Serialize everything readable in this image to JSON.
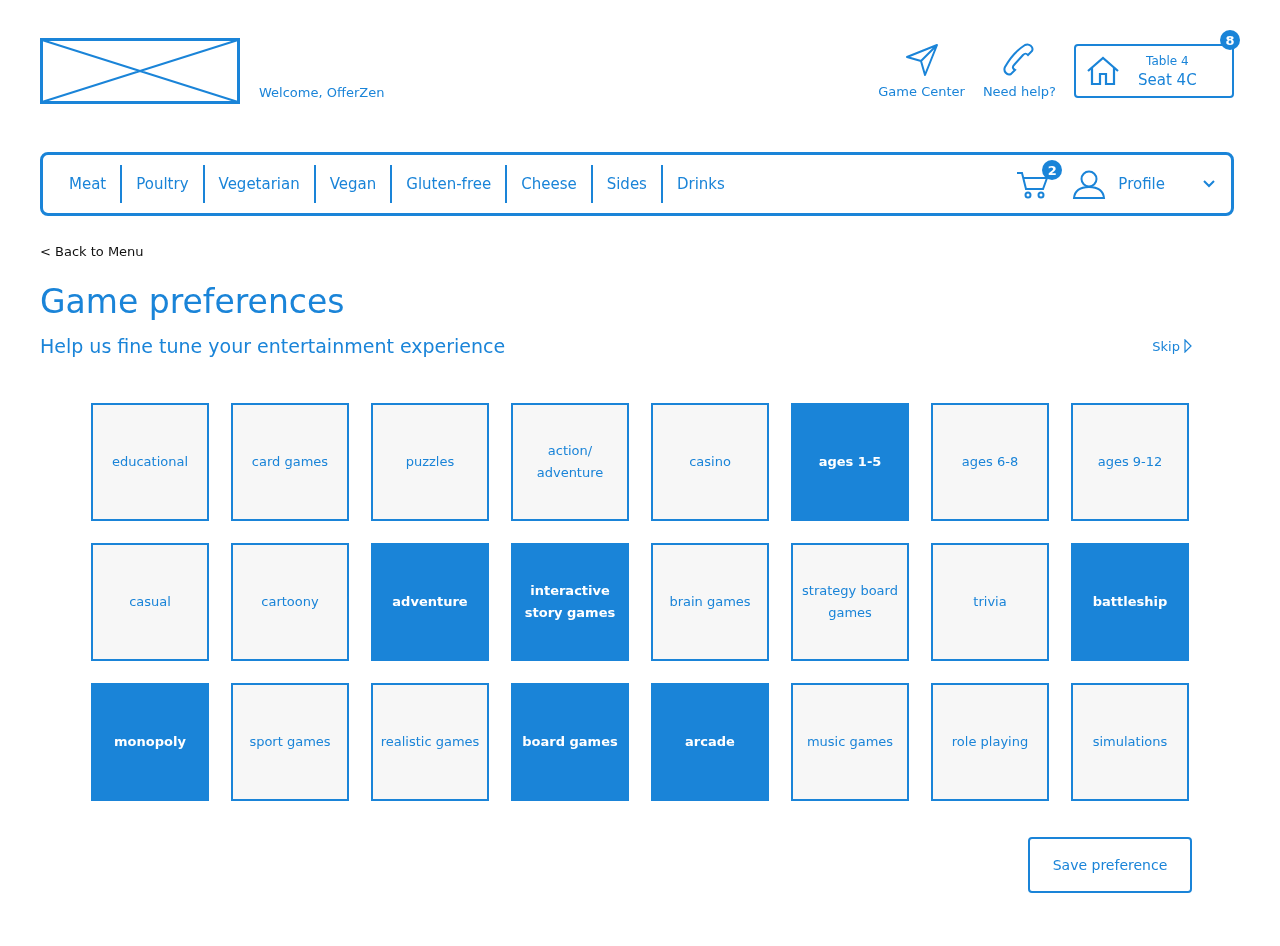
{
  "header": {
    "welcome": "Welcome, OfferZen",
    "actions": [
      {
        "kind": "send",
        "label": "Game Center"
      },
      {
        "kind": "phone",
        "label": "Need help?"
      }
    ],
    "seat": {
      "table": "Table 4",
      "seat": "Seat 4C",
      "badge": "8"
    }
  },
  "nav": {
    "items": [
      "Meat",
      "Poultry",
      "Vegetarian",
      "Vegan",
      "Gluten-free",
      "Cheese",
      "Sides",
      "Drinks"
    ],
    "cart_count": "2",
    "profile": "Profile"
  },
  "back_link": "< Back to Menu",
  "title": "Game preferences",
  "subtitle": "Help us fine tune your entertainment experience",
  "skip": "Skip",
  "tiles": [
    {
      "label": "educational",
      "selected": false
    },
    {
      "label": "card games",
      "selected": false
    },
    {
      "label": "puzzles",
      "selected": false
    },
    {
      "label": "action/ adventure",
      "selected": false
    },
    {
      "label": "casino",
      "selected": false
    },
    {
      "label": "ages 1-5",
      "selected": true
    },
    {
      "label": "ages 6-8",
      "selected": false
    },
    {
      "label": "ages 9-12",
      "selected": false
    },
    {
      "label": "casual",
      "selected": false
    },
    {
      "label": "cartoony",
      "selected": false
    },
    {
      "label": "adventure",
      "selected": true
    },
    {
      "label": "interactive story games",
      "selected": true
    },
    {
      "label": "brain games",
      "selected": false
    },
    {
      "label": "strategy board games",
      "selected": false
    },
    {
      "label": "trivia",
      "selected": false
    },
    {
      "label": "battleship",
      "selected": true
    },
    {
      "label": "monopoly",
      "selected": true
    },
    {
      "label": "sport games",
      "selected": false
    },
    {
      "label": "realistic games",
      "selected": false
    },
    {
      "label": "board games",
      "selected": true
    },
    {
      "label": "arcade",
      "selected": true
    },
    {
      "label": "music games",
      "selected": false
    },
    {
      "label": "role playing",
      "selected": false
    },
    {
      "label": "simulations",
      "selected": false
    }
  ],
  "save_button": "Save preference"
}
